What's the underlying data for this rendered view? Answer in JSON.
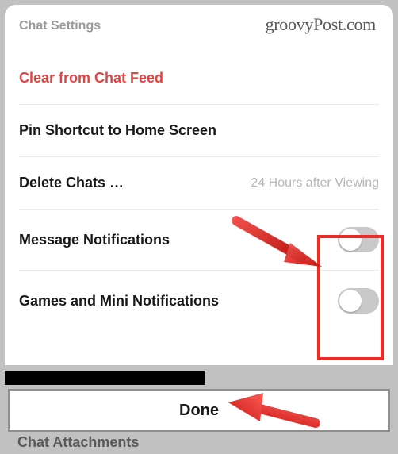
{
  "header": {
    "title": "Chat Settings"
  },
  "watermark": "groovyPost.com",
  "items": {
    "clear_feed": {
      "label": "Clear from Chat Feed"
    },
    "pin_shortcut": {
      "label": "Pin Shortcut to Home Screen"
    },
    "delete_chats": {
      "label": "Delete Chats …",
      "value": "24 Hours after Viewing"
    },
    "message_notifications": {
      "label": "Message Notifications"
    },
    "games_notifications": {
      "label": "Games and Mini Notifications"
    }
  },
  "done": {
    "label": "Done"
  },
  "footer_peek": "Chat Attachments"
}
